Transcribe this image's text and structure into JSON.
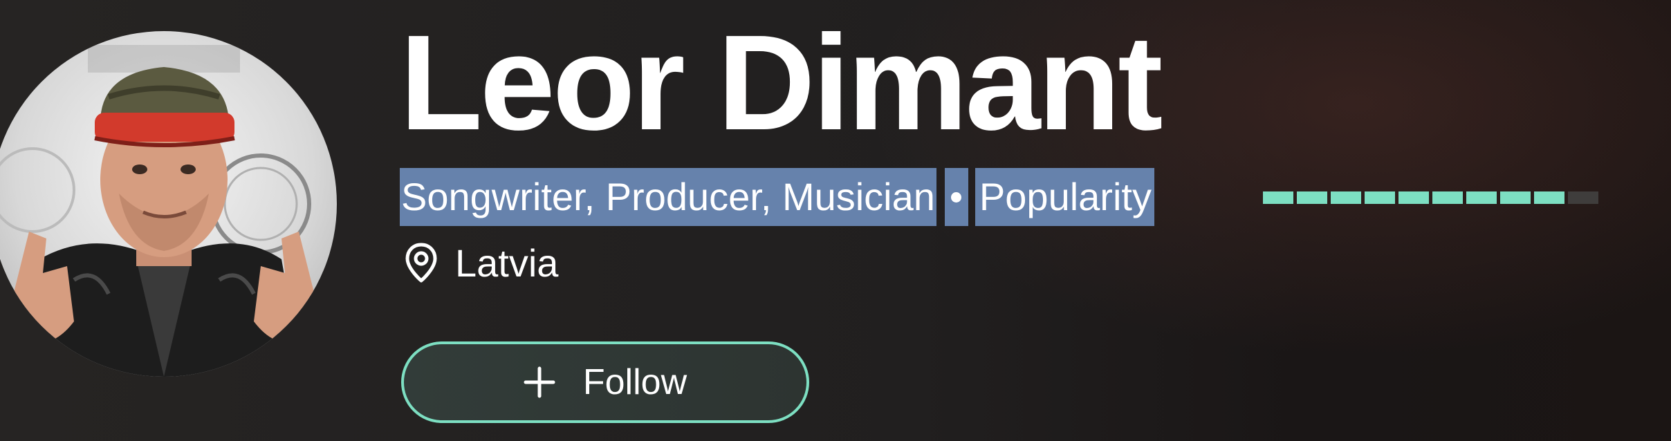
{
  "artist": {
    "name": "Leor Dimant",
    "roles": "Songwriter, Producer, Musician",
    "separator": "•",
    "popularity_label": "Popularity",
    "popularity": {
      "filled": 9,
      "total": 10
    },
    "location": "Latvia",
    "avatar": "artist-photo"
  },
  "actions": {
    "follow_label": "Follow",
    "follow_icon": "plus-icon"
  },
  "colors": {
    "accent": "#7ddfc2",
    "selection": "#6682ac",
    "meter_off": "#3f3d3c",
    "text": "#ffffff"
  },
  "icons": {
    "location": "location-pin-icon"
  }
}
